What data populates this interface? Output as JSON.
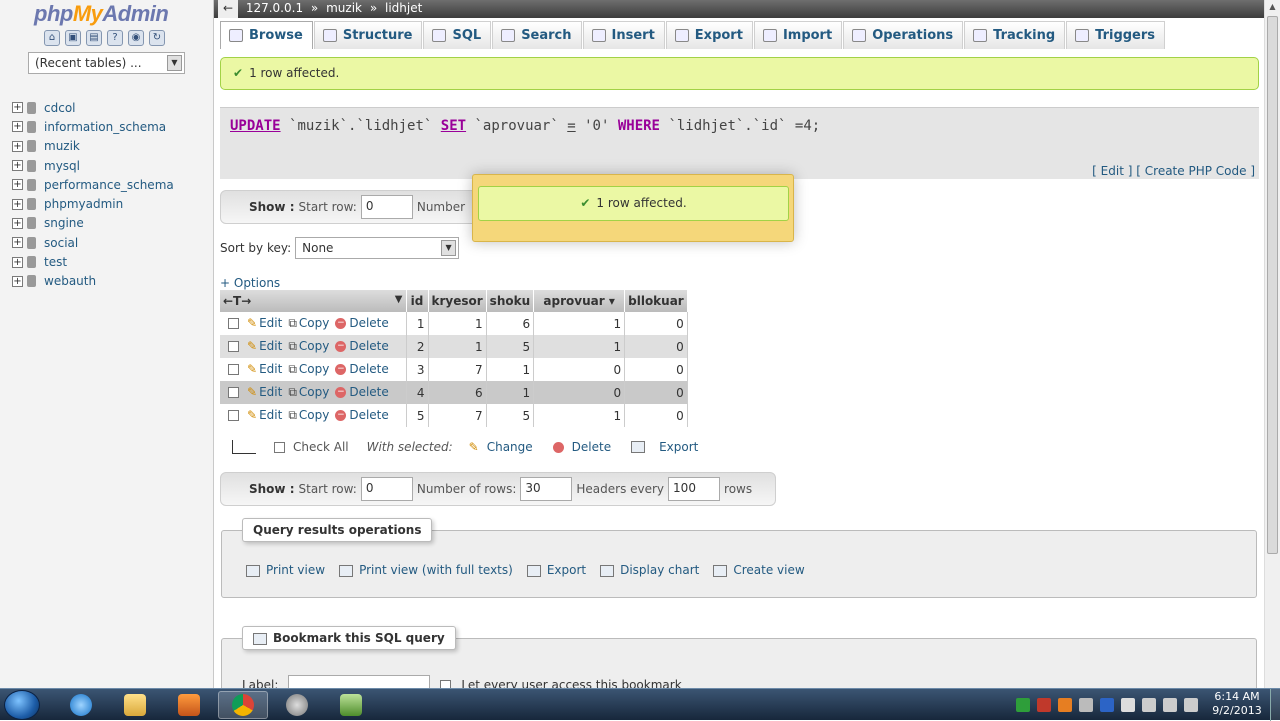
{
  "sidebar": {
    "logo_php": "php",
    "logo_my": "My",
    "logo_admin": "Admin",
    "recent_tables": "(Recent tables) ...",
    "databases": [
      "cdcol",
      "information_schema",
      "muzik",
      "mysql",
      "performance_schema",
      "phpmyadmin",
      "sngine",
      "social",
      "test",
      "webauth"
    ]
  },
  "breadcrumb": {
    "back": "←",
    "server": "127.0.0.1",
    "sep1": "»",
    "db": "muzik",
    "sep2": "»",
    "table": "lidhjet"
  },
  "tabs": [
    "Browse",
    "Structure",
    "SQL",
    "Search",
    "Insert",
    "Export",
    "Import",
    "Operations",
    "Tracking",
    "Triggers"
  ],
  "message": {
    "text": "1 row affected.",
    "check": "✔"
  },
  "sql": {
    "update": "UPDATE",
    "db": "`muzik`",
    "dot1": ".",
    "table": "`lidhjet`",
    "set": "SET",
    "col": "`aprovuar`",
    "eq": "=",
    "val": "'0'",
    "where": "WHERE",
    "table2": "`lidhjet`",
    "dot2": ".",
    "col2": "`id`",
    "eq2": "=4;"
  },
  "sql_links": {
    "open": "[",
    "edit": "Edit",
    "mid": "] [",
    "php": "Create PHP Code",
    "close": "]"
  },
  "navbar": {
    "show": "Show :",
    "start_row_label": "Start row:",
    "start_row": "0",
    "num_rows_label": "Number of rows:",
    "num_rows": "30",
    "headers_label": "Headers every",
    "headers": "100",
    "rows": "rows",
    "trunc_label": "Number"
  },
  "sort": {
    "label": "Sort by key:",
    "value": "None"
  },
  "options": "+ Options",
  "popup": {
    "text": "1 row affected."
  },
  "table": {
    "arrows": "←T→",
    "sort_arrow": "▼",
    "columns": [
      "id",
      "kryesor",
      "shoku",
      "aprovuar",
      "bllokuar"
    ],
    "aprovuar_sort": "▾",
    "actions": {
      "edit": "Edit",
      "copy": "Copy",
      "delete": "Delete"
    },
    "rows": [
      {
        "id": "1",
        "kryesor": "1",
        "shoku": "6",
        "aprovuar": "1",
        "bllokuar": "0"
      },
      {
        "id": "2",
        "kryesor": "1",
        "shoku": "5",
        "aprovuar": "1",
        "bllokuar": "0"
      },
      {
        "id": "3",
        "kryesor": "7",
        "shoku": "1",
        "aprovuar": "0",
        "bllokuar": "0"
      },
      {
        "id": "4",
        "kryesor": "6",
        "shoku": "1",
        "aprovuar": "0",
        "bllokuar": "0"
      },
      {
        "id": "5",
        "kryesor": "7",
        "shoku": "5",
        "aprovuar": "1",
        "bllokuar": "0"
      }
    ]
  },
  "bulk": {
    "check_all": "Check All",
    "with_selected": "With selected:",
    "change": "Change",
    "delete": "Delete",
    "export": "Export"
  },
  "qro": {
    "legend": "Query results operations",
    "print_view": "Print view",
    "print_full": "Print view (with full texts)",
    "export": "Export",
    "display_chart": "Display chart",
    "create_view": "Create view"
  },
  "bookmark": {
    "legend": "Bookmark this SQL query",
    "label": "Label:",
    "access": "Let every user access this bookmark"
  },
  "clock": {
    "time": "6:14 AM",
    "date": "9/2/2013"
  },
  "colors": {
    "accent": "#235a81",
    "success_bg": "#ebf8a4",
    "popup_bg": "#f5d77a"
  }
}
